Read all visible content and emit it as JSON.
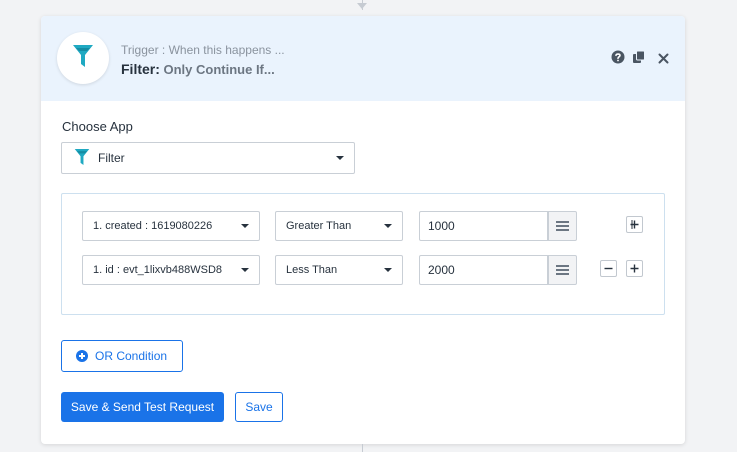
{
  "header": {
    "subtitle": "Trigger : When this happens ...",
    "title_bold": "Filter:",
    "title_rest": " Only Continue If...",
    "app_icon": "filter-icon",
    "actions": [
      "help-icon",
      "copy-icon",
      "close-icon"
    ]
  },
  "choose_app": {
    "label": "Choose App",
    "selected": "Filter",
    "icon": "filter-icon"
  },
  "conditions": [
    {
      "field": "1. created : 1619080226",
      "operator": "Greater Than",
      "value": "1000",
      "buttons": [
        "add"
      ]
    },
    {
      "field": "1. id : evt_1lixvb488WSD8",
      "operator": "Less Than",
      "value": "2000",
      "buttons": [
        "remove",
        "add"
      ]
    }
  ],
  "buttons": {
    "or_condition": "OR Condition",
    "save_and_send": "Save & Send Test Request",
    "save": "Save"
  },
  "colors": {
    "accent": "#1a73e8",
    "header_bg": "#eaf3fd",
    "filter_icon": "#1fa9c2"
  }
}
